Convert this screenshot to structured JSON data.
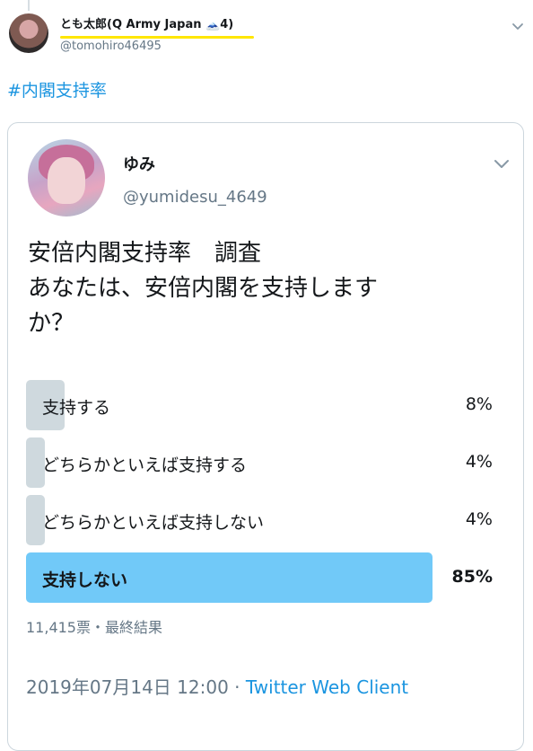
{
  "outer_tweet": {
    "display_name": "とも太郎(Q Army Japan 🗻4)",
    "handle": "@tomohiro46495",
    "hashtag": "#内閣支持率"
  },
  "quoted_tweet": {
    "display_name": "ゆみ",
    "handle": "@yumidesu_4649",
    "question": "安倍内閣支持率　調査\nあなたは、安倍内閣を支持します\nか？",
    "poll": {
      "options": [
        {
          "label": "支持する",
          "percent_text": "8%",
          "percent": 8,
          "winner": false
        },
        {
          "label": "どちらかといえば支持する",
          "percent_text": "4%",
          "percent": 4,
          "winner": false
        },
        {
          "label": "どちらかといえば支持しない",
          "percent_text": "4%",
          "percent": 4,
          "winner": false
        },
        {
          "label": "支持しない",
          "percent_text": "85%",
          "percent": 85,
          "winner": true
        }
      ],
      "meta": "11,415票・最終結果"
    },
    "timestamp": "2019年07月14日 12:00",
    "separator": " · ",
    "client": "Twitter Web Client"
  },
  "colors": {
    "accent": "#1b95e0",
    "winner_bar": "#71c9f8",
    "bar": "#cfd9de",
    "highlight": "#ffe600"
  },
  "icons": {
    "outer_caret": "chevron-down-icon",
    "inner_caret": "chevron-down-icon"
  }
}
